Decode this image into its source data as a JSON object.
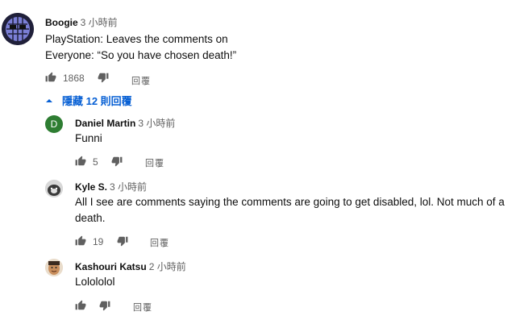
{
  "top_comment": {
    "author": "Boogie",
    "time": "3 小時前",
    "lines": [
      "PlayStation: Leaves the comments on",
      "Everyone: “So you have chosen death!”"
    ],
    "likes": "1868",
    "reply_label": "回覆"
  },
  "replies_toggle": {
    "label": "隱藏 12 則回覆"
  },
  "replies": [
    {
      "author": "Daniel Martin",
      "avatar_letter": "D",
      "time": "3 小時前",
      "lines": [
        "Funni"
      ],
      "likes": "5",
      "reply_label": "回覆"
    },
    {
      "author": "Kyle S.",
      "time": "3 小時前",
      "lines": [
        "All I see are comments saying the comments are going to get disabled, lol. Not much of a",
        "death."
      ],
      "likes": "19",
      "reply_label": "回覆"
    },
    {
      "author": "Kashouri Katsu",
      "time": "2 小時前",
      "lines": [
        "Lolololol"
      ],
      "likes": "",
      "reply_label": "回覆"
    }
  ],
  "colors": {
    "link": "#065fd4",
    "daniel_avatar": "#2e7d32",
    "meta": "#606060"
  }
}
